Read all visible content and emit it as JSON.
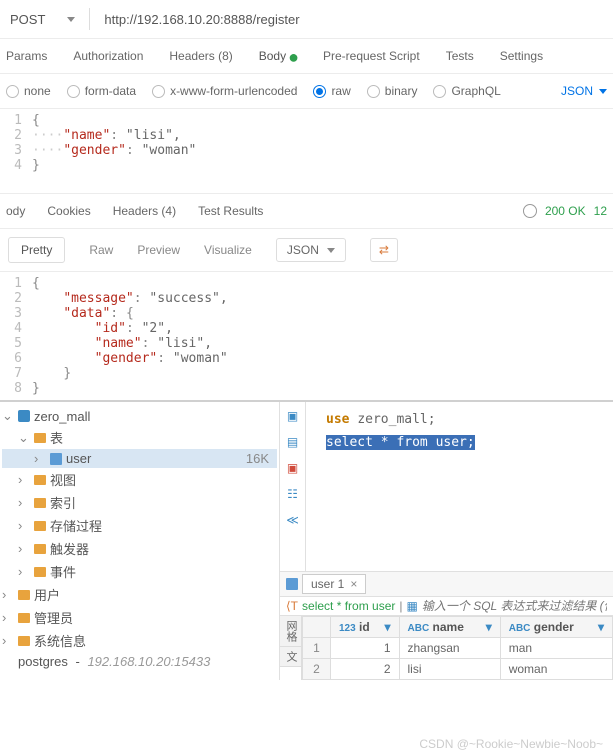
{
  "request": {
    "method": "POST",
    "url": "http://192.168.10.20:8888/register"
  },
  "req_tabs": {
    "params": "Params",
    "auth": "Authorization",
    "headers": "Headers (8)",
    "body": "Body",
    "prereq": "Pre-request Script",
    "tests": "Tests",
    "settings": "Settings"
  },
  "body_types": {
    "none": "none",
    "form": "form-data",
    "xwww": "x-www-form-urlencoded",
    "raw": "raw",
    "binary": "binary",
    "graphql": "GraphQL",
    "json": "JSON"
  },
  "req_body": [
    {
      "n": "1",
      "c": "{"
    },
    {
      "n": "2",
      "c": "····\"name\": \"lisi\","
    },
    {
      "n": "3",
      "c": "····\"gender\": \"woman\""
    },
    {
      "n": "4",
      "c": "}"
    }
  ],
  "resp_tabs": {
    "body": "ody",
    "cookies": "Cookies",
    "headers": "Headers (4)",
    "results": "Test Results"
  },
  "status": {
    "code": "200 OK",
    "time": "12"
  },
  "view_tabs": {
    "pretty": "Pretty",
    "raw": "Raw",
    "preview": "Preview",
    "visualize": "Visualize",
    "json": "JSON"
  },
  "resp_body": [
    {
      "n": "1",
      "c": "{"
    },
    {
      "n": "2",
      "c": "    \"message\": \"success\","
    },
    {
      "n": "3",
      "c": "    \"data\": {"
    },
    {
      "n": "4",
      "c": "        \"id\": \"2\","
    },
    {
      "n": "5",
      "c": "        \"name\": \"lisi\","
    },
    {
      "n": "6",
      "c": "        \"gender\": \"woman\""
    },
    {
      "n": "7",
      "c": "    }"
    },
    {
      "n": "8",
      "c": "}"
    }
  ],
  "tree": {
    "db": "zero_mall",
    "tables_label": "表",
    "table": "user",
    "table_size": "16K",
    "views": "视图",
    "indexes": "索引",
    "procs": "存储过程",
    "triggers": "触发器",
    "events": "事件",
    "users": "用户",
    "admins": "管理员",
    "sysinfo": "系统信息",
    "pg": "postgres",
    "pg_host": "192.168.10.20:15433"
  },
  "sql": {
    "use": "use zero_mall;",
    "select": "select * from user;"
  },
  "result": {
    "tab": "user 1",
    "query": "select * from user",
    "filter_ph": "输入一个 SQL 表达式来过滤结果 (使",
    "side1": "网格",
    "side2": "文",
    "cols": {
      "id": "id",
      "name": "name",
      "gender": "gender"
    },
    "col_type1": "123",
    "col_type2": "ABC",
    "rows": [
      {
        "idx": "1",
        "id": "1",
        "name": "zhangsan",
        "gender": "man"
      },
      {
        "idx": "2",
        "id": "2",
        "name": "lisi",
        "gender": "woman"
      }
    ]
  },
  "watermark": "CSDN @~Rookie~Newbie~Noob~"
}
